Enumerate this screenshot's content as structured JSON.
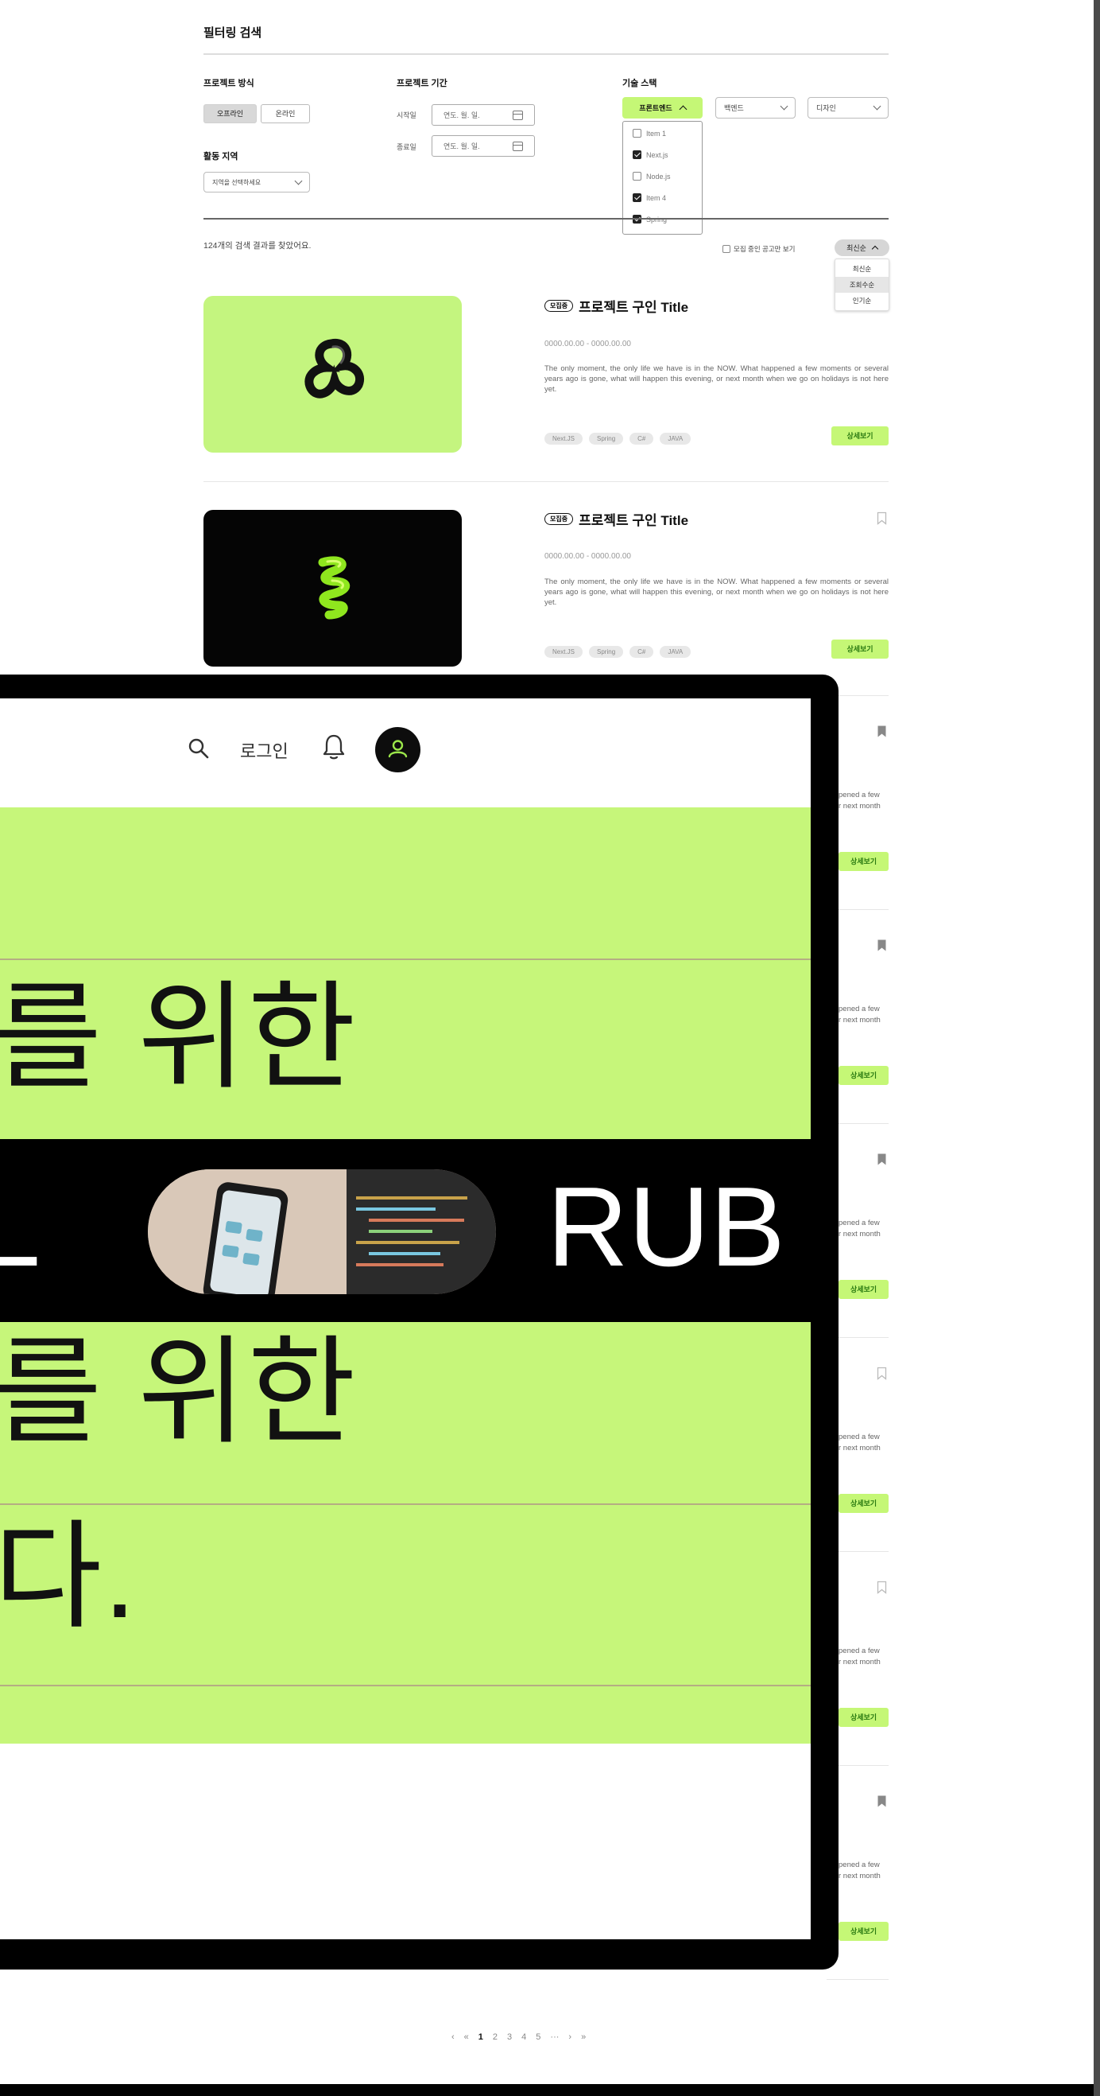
{
  "filter": {
    "heading": "필터링 검색",
    "method_label": "프로젝트 방식",
    "method_options": [
      "오프라인",
      "온라인"
    ],
    "region_label": "활동 지역",
    "region_placeholder": "지역을 선택하세요",
    "period_label": "프로젝트 기간",
    "start_label": "시작일",
    "end_label": "종료일",
    "date_placeholder": "연도. 월. 일.",
    "stack_label": "기술 스택",
    "stack_dropdowns": [
      "프론트엔드",
      "백엔드",
      "디자인"
    ],
    "stack_items": [
      {
        "label": "Item 1",
        "checked": false
      },
      {
        "label": "Next.js",
        "checked": true
      },
      {
        "label": "Node.js",
        "checked": false
      },
      {
        "label": "Item 4",
        "checked": true
      },
      {
        "label": "Spring",
        "checked": true
      }
    ]
  },
  "results": {
    "count_text": "124개의 검색 결과를 찾았어요.",
    "open_only_label": "모집 중인 공고만 보기",
    "sort_selected": "최신순",
    "sort_options": [
      "최신순",
      "조회수순",
      "인기순"
    ]
  },
  "cards": [
    {
      "badge": "모집중",
      "title": "프로젝트 구인 Title",
      "period": "0000.00.00 - 0000.00.00",
      "desc": "The only moment, the only life we have is in the NOW. What happened a few moments or several years ago is gone, what will happen this evening, or next month when we go on holidays is not here yet.",
      "tags": [
        "Next.JS",
        "Spring",
        "C#",
        "JAVA"
      ],
      "button": "상세보기",
      "bookmarked": false
    },
    {
      "badge": "모집중",
      "title": "프로젝트 구인 Title",
      "period": "0000.00.00 - 0000.00.00",
      "desc": "The only moment, the only life we have is in the NOW. What happened a few moments or several years ago is gone, what will happen this evening, or next month when we go on holidays is not here yet.",
      "tags": [
        "Next.JS",
        "Spring",
        "C#",
        "JAVA"
      ],
      "button": "상세보기",
      "bookmarked": false
    }
  ],
  "partial_rows": [
    {
      "text_a": "pened a few",
      "text_b": "r next month",
      "button": "상세보기",
      "bookmarked": true
    },
    {
      "text_a": "pened a few",
      "text_b": "r next month",
      "button": "상세보기",
      "bookmarked": true
    },
    {
      "text_a": "pened a few",
      "text_b": "r next month",
      "button": "상세보기",
      "bookmarked": true
    },
    {
      "text_a": "pened a few",
      "text_b": "r next month",
      "button": "상세보기",
      "bookmarked": false
    },
    {
      "text_a": "pened a few",
      "text_b": "r next month",
      "button": "상세보기",
      "bookmarked": false
    },
    {
      "text_a": "pened a few",
      "text_b": "r next month",
      "button": "상세보기",
      "bookmarked": true
    }
  ],
  "pagination": {
    "items": [
      "‹",
      "«",
      "1",
      "2",
      "3",
      "4",
      "5",
      "···",
      "›",
      "»"
    ],
    "current": "1"
  },
  "overlay": {
    "login": "로그인",
    "headline_1": "를 위한",
    "marquee_left": "L",
    "marquee_right": "RUB",
    "headline_2": "를 위한",
    "headline_3": "다."
  },
  "colors": {
    "accent": "#c5f776",
    "accent_text": "#2a7a11",
    "dark": "#000000"
  }
}
